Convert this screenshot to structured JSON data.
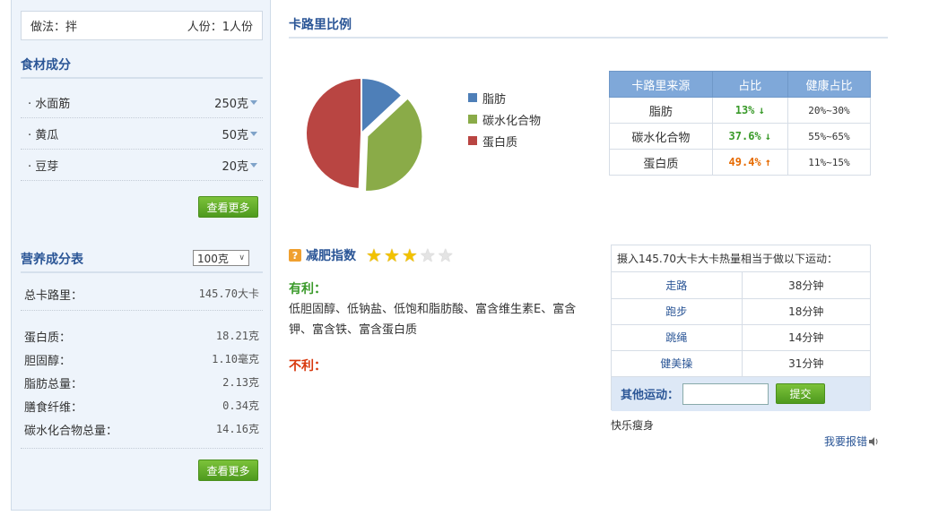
{
  "method": {
    "label": "做法：拌",
    "servings": "人份：1人份"
  },
  "ingredients": {
    "title": "食材成分",
    "items": [
      {
        "name": "· 水面筋",
        "amount": "250克"
      },
      {
        "name": "· 黄瓜",
        "amount": "50克"
      },
      {
        "name": "· 豆芽",
        "amount": "20克"
      }
    ],
    "more_label": "查看更多"
  },
  "nutrition": {
    "title": "营养成分表",
    "unit_select": "100克",
    "total_label": "总卡路里：",
    "total_value": "145.70大卡",
    "rows": [
      {
        "label": "蛋白质：",
        "value": "18.21克"
      },
      {
        "label": "胆固醇：",
        "value": "1.10毫克"
      },
      {
        "label": "脂肪总量：",
        "value": "2.13克"
      },
      {
        "label": "膳食纤维：",
        "value": "0.34克"
      },
      {
        "label": "碳水化合物总量：",
        "value": "14.16克"
      }
    ],
    "more_label": "查看更多"
  },
  "calorie": {
    "title": "卡路里比例",
    "legend": [
      {
        "name": "脂肪",
        "color": "#4e7fb8"
      },
      {
        "name": "碳水化合物",
        "color": "#8aab48"
      },
      {
        "name": "蛋白质",
        "color": "#b94542"
      }
    ],
    "table": {
      "headers": [
        "卡路里来源",
        "占比",
        "健康占比"
      ],
      "rows": [
        {
          "source": "脂肪",
          "ratio": "13%",
          "trend": "down",
          "arrow": "↓",
          "healthy": "20%~30%"
        },
        {
          "source": "碳水化合物",
          "ratio": "37.6%",
          "trend": "down",
          "arrow": "↓",
          "healthy": "55%~65%"
        },
        {
          "source": "蛋白质",
          "ratio": "49.4%",
          "trend": "up",
          "arrow": "↑",
          "healthy": "11%~15%"
        }
      ]
    }
  },
  "chart_data": {
    "type": "pie",
    "categories": [
      "脂肪",
      "碳水化合物",
      "蛋白质"
    ],
    "values": [
      13,
      37.6,
      49.4
    ],
    "colors": [
      "#4e7fb8",
      "#8aab48",
      "#b94542"
    ],
    "legend": "right"
  },
  "diet": {
    "label": "减肥指数",
    "rating": 3,
    "max": 5,
    "good_label": "有利：",
    "good_text": "低胆固醇、低钠盐、低饱和脂肪酸、富含维生素E、富含钾、富含铁、富含蛋白质",
    "bad_label": "不利："
  },
  "exercise": {
    "header": "摄入145.70大卡大卡热量相当于做以下运动：",
    "items": [
      {
        "name": "走路",
        "time": "38分钟"
      },
      {
        "name": "跑步",
        "time": "18分钟"
      },
      {
        "name": "跳绳",
        "time": "14分钟"
      },
      {
        "name": "健美操",
        "time": "31分钟"
      }
    ],
    "other_label": "其他运动：",
    "submit_label": "提交"
  },
  "footer": {
    "happy": "快乐瘦身",
    "report": "我要报错"
  }
}
